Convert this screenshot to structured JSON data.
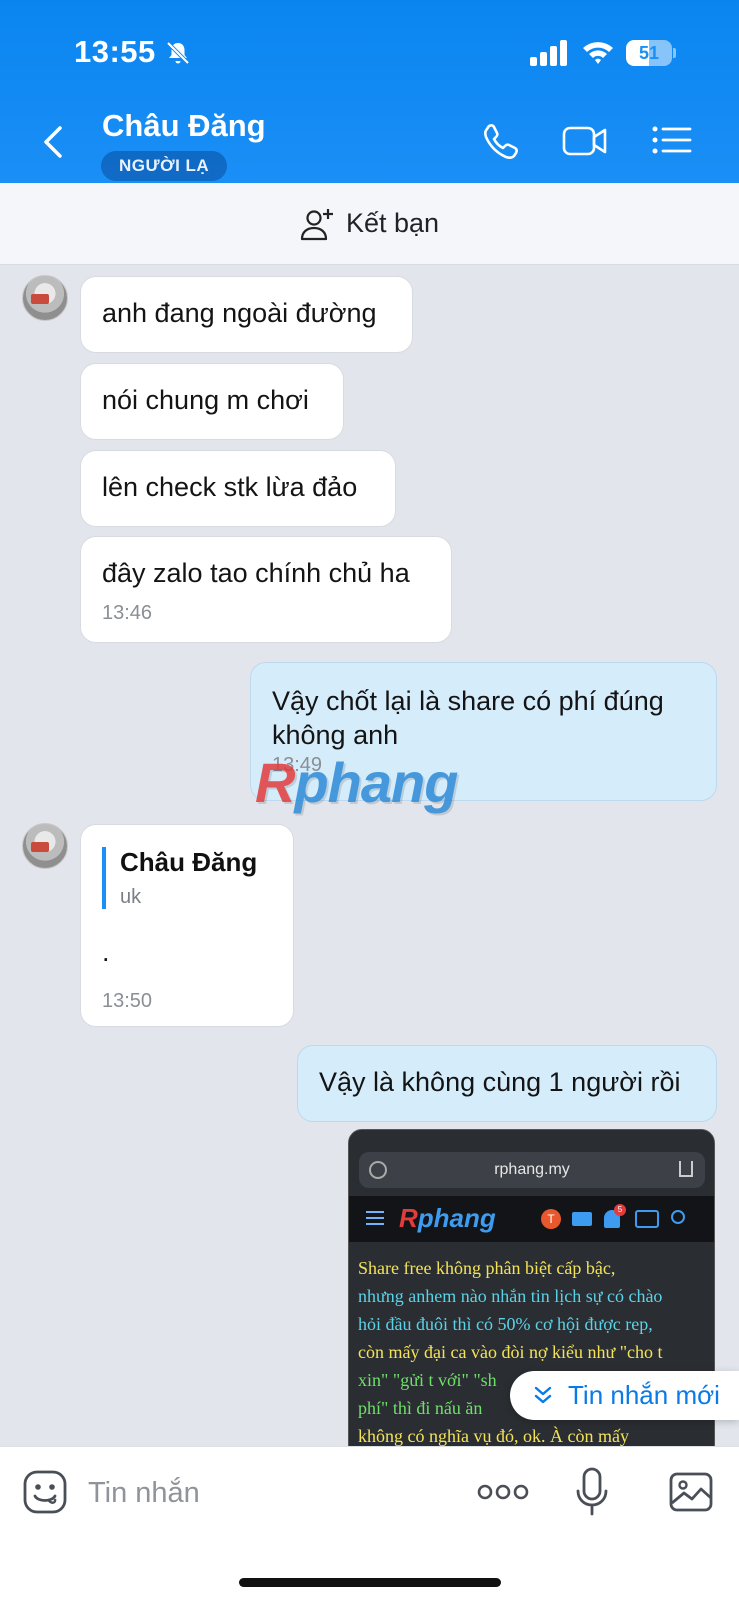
{
  "status_bar": {
    "time": "13:55",
    "battery": "51",
    "battery_level": 0.51
  },
  "header": {
    "contact_name": "Châu Đăng",
    "badge": "NGƯỜI LẠ",
    "icons": [
      "back-icon",
      "phone-icon",
      "video-call-icon",
      "menu-list-icon"
    ]
  },
  "add_friend": {
    "label": "Kết bạn",
    "icon": "add-person-icon"
  },
  "messages": [
    {
      "dir": "in",
      "text": "anh đang ngoài đường"
    },
    {
      "dir": "in",
      "text": "nói chung m chơi"
    },
    {
      "dir": "in",
      "text": "lên check stk lừa đảo"
    },
    {
      "dir": "in",
      "text": "đây zalo tao chính chủ ha",
      "time": "13:46"
    },
    {
      "dir": "out",
      "text_line1": "Vậy chốt lại là share có phí đúng",
      "text_line2": "không anh",
      "time": "13:49"
    },
    {
      "dir": "in",
      "reply_name": "Châu Đăng",
      "reply_text": "uk",
      "text": ".",
      "time": "13:50"
    },
    {
      "dir": "out",
      "text": "Vậy là không cùng 1 người rồi"
    }
  ],
  "watermark": {
    "first": "R",
    "rest": "phang"
  },
  "shared_image": {
    "url": "rphang.my",
    "logo_first": "R",
    "logo_rest": "phang",
    "avatar_letter": "T",
    "notif_count": "5",
    "lines": [
      "Share free không phân biệt cấp bậc,",
      "nhưng anhem nào nhắn tin lịch sự có chào",
      "hỏi đầu đuôi thì có 50% cơ hội được rep,",
      "còn mấy đại ca vào đòi nợ kiểu như \"cho t",
      "xin\" \"gửi t với\" \"sh",
      "phí\" thì đi nấu ăn",
      "không có nghĩa vụ đó, ok. À còn mấy"
    ],
    "colors": {
      "yellow": "#f3e35a",
      "cyan": "#5ad3e8",
      "green": "#6fe06a",
      "red": "#e23b3b"
    }
  },
  "new_message_pill": {
    "label": "Tin nhắn mới"
  },
  "input_bar": {
    "placeholder": "Tin nhắn",
    "icons": [
      "emoji-sticker-icon",
      "more-dots-icon",
      "microphone-icon",
      "image-gallery-icon"
    ]
  },
  "colors": {
    "accent": "#1a8ff6",
    "outgoing_bubble": "#d5ecfb",
    "background": "#e2e6ec"
  }
}
